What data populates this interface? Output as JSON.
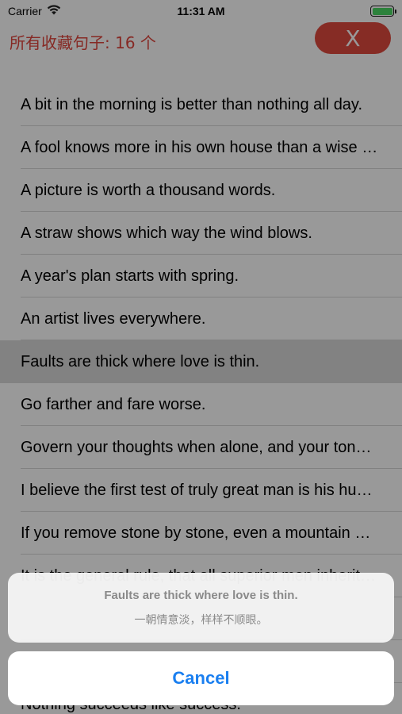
{
  "status_bar": {
    "carrier": "Carrier",
    "time": "11:31 AM"
  },
  "header": {
    "title": "所有收藏句子: 16 个",
    "close_label": "X"
  },
  "list": {
    "items": [
      "A bit in the morning is better than nothing all day.",
      "A fool knows more in his own house than a wise man in another's.",
      "A picture is worth a thousand words.",
      "A straw shows which way the wind blows.",
      "A year's plan starts with spring.",
      "An artist lives everywhere.",
      "Faults are thick where love is thin.",
      "Go farther and fare worse.",
      "Govern your thoughts when alone, and your tongue when in company.",
      "I believe the first test of truly great man is his humility.",
      "If you remove stone by stone, even a mountain will be leveled.",
      "It is the general rule, that all superior men inherit the elements of superiority from their mothers.",
      "",
      "",
      "Nothing succeeds like success."
    ],
    "selected_index": 6
  },
  "action_sheet": {
    "title": "Faults are thick where love is thin.",
    "subtitle": "一朝情意淡，样样不顺眼。",
    "cancel_label": "Cancel"
  },
  "colors": {
    "accent": "#e0453c",
    "link_blue": "#1a7ff0",
    "battery": "#4cd964"
  }
}
